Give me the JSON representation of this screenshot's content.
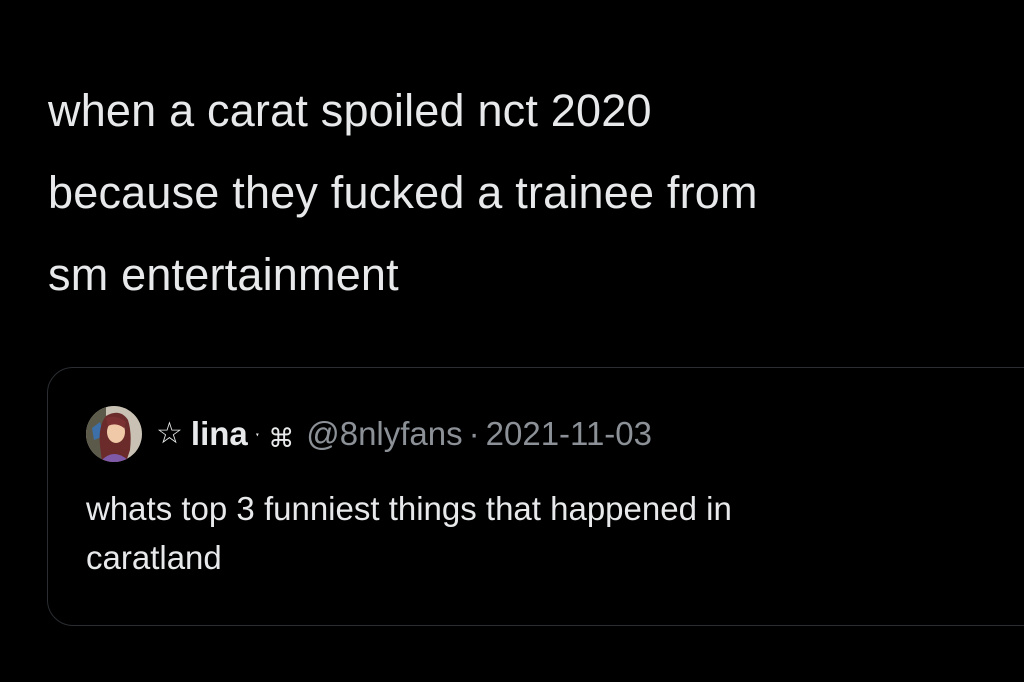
{
  "tweet": {
    "text_lines": [
      "when a carat spoiled nct 2020",
      "because they fucked a trainee from",
      "sm entertainment"
    ]
  },
  "quoted_tweet": {
    "name_prefix_icon": "outline-star-icon",
    "display_name": "lina",
    "name_suffix": "ˑ ⌘",
    "handle": "@8nlyfans",
    "separator": "·",
    "date": "2021-11-03",
    "text_lines": [
      "whats top 3 funniest things that happened in",
      "caratland"
    ]
  },
  "colors": {
    "background": "#000000",
    "primary_text": "#e7e9ea",
    "secondary_text": "#8b9197",
    "border": "#2a2d31"
  }
}
